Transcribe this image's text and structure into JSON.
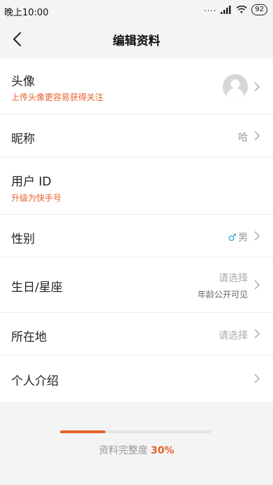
{
  "status_bar": {
    "time": "晚上10:00",
    "battery": "92"
  },
  "nav": {
    "title": "编辑资料"
  },
  "rows": {
    "avatar": {
      "label": "头像",
      "sub": "上传头像更容易获得关注"
    },
    "nickname": {
      "label": "昵称",
      "value": "哈"
    },
    "userid": {
      "label": "用户 ID",
      "sub": "升级为快手号"
    },
    "gender": {
      "label": "性别",
      "value": "男",
      "icon": "♂"
    },
    "birthday": {
      "label": "生日/星座",
      "value": "请选择",
      "note": "年龄公开可见"
    },
    "location": {
      "label": "所在地",
      "value": "请选择"
    },
    "bio": {
      "label": "个人介绍"
    }
  },
  "progress": {
    "label": "资料完整度",
    "percent_text": "30%",
    "value": 0.3
  },
  "colors": {
    "accent": "#e8602c",
    "male": "#3aa0d8"
  }
}
